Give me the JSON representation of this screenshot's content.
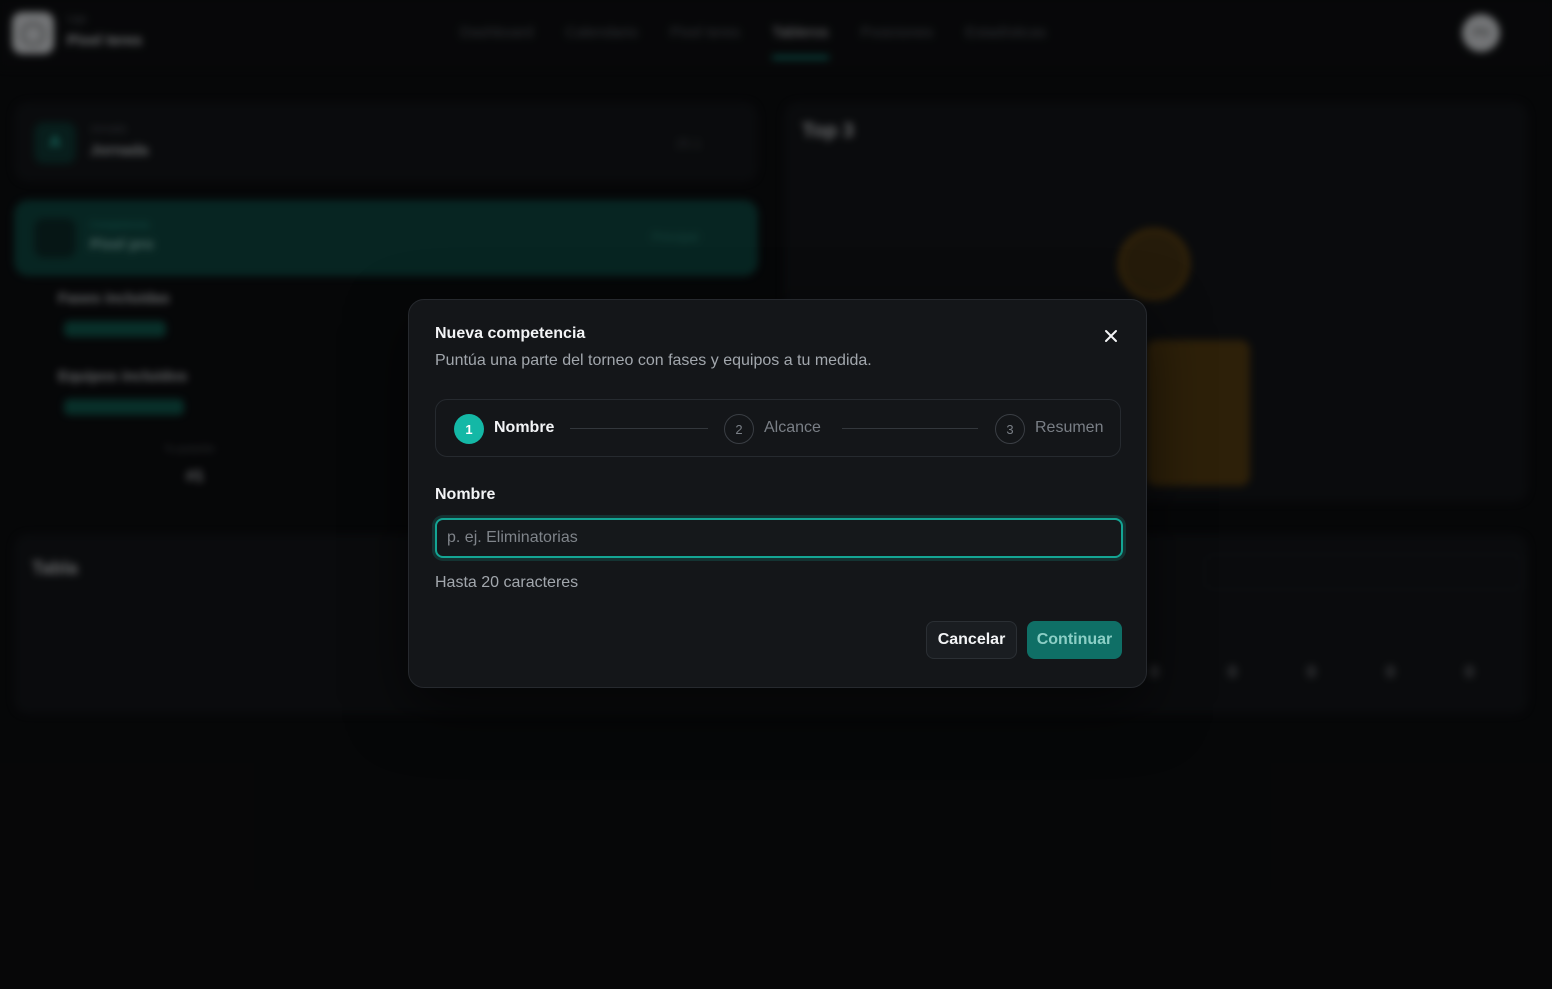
{
  "background": {
    "brand": {
      "small": "Liga",
      "name": "Pixel teres"
    },
    "nav": [
      "Dashboard",
      "Calendario",
      "Pixel teres",
      "Tableros",
      "Posiciones",
      "Estadísticas"
    ],
    "nav_active": "Tableros",
    "avatar_initials": "PN",
    "season": {
      "label": "Jornada",
      "value": "Jornada",
      "right": "25.1"
    },
    "competition": {
      "label": "Competencia",
      "value": "Pixel pro",
      "right": "Principal"
    },
    "filters": [
      "Fases incluidas",
      "Equipos incluidos"
    ],
    "filter_tags": [
      "Todas las fases",
      "Todos los equipos"
    ],
    "stat": {
      "label": "Tu posición",
      "value": "#1"
    },
    "top3_title": "Top 3",
    "table_title": "Tabla",
    "table_values": [
      "0",
      "0",
      "0",
      "0",
      "0"
    ]
  },
  "modal": {
    "title": "Nueva competencia",
    "description": "Puntúa una parte del torneo con fases y equipos a tu medida.",
    "steps": [
      {
        "number": "1",
        "label": "Nombre"
      },
      {
        "number": "2",
        "label": "Alcance"
      },
      {
        "number": "3",
        "label": "Resumen"
      }
    ],
    "field_label": "Nombre",
    "input": {
      "value": "",
      "placeholder": "p. ej. Eliminatorias"
    },
    "hint": "Hasta 20 caracteres",
    "cancel_label": "Cancelar",
    "continue_label": "Continuar"
  },
  "colors": {
    "accent": "#14b8a6",
    "background": "#0a0b0d",
    "modal_bg": "#141619",
    "gold": "#6f4c0f"
  },
  "icons": {
    "close": "close-icon"
  }
}
